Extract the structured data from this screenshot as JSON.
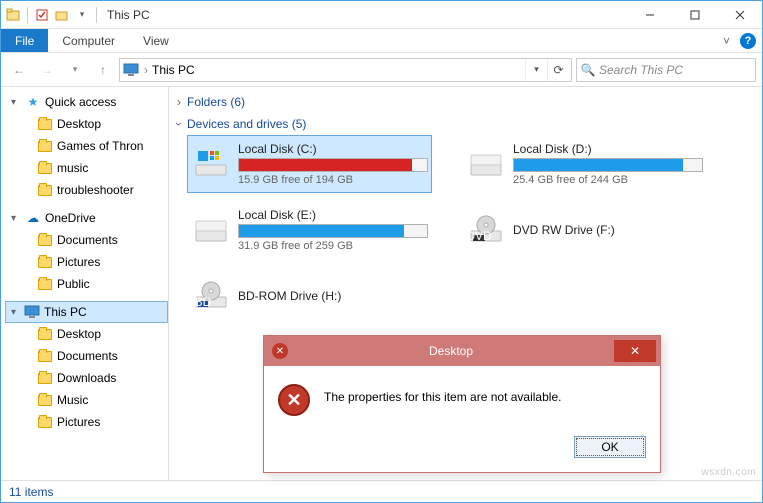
{
  "title": "This PC",
  "ribbon": {
    "file": "File",
    "computer": "Computer",
    "view": "View"
  },
  "address": {
    "segment": "This PC"
  },
  "search": {
    "placeholder": "Search This PC"
  },
  "sidebar": {
    "quick_access": "Quick access",
    "qa_items": [
      "Desktop",
      "Games of Thron",
      "music",
      "troubleshooter"
    ],
    "onedrive": "OneDrive",
    "od_items": [
      "Documents",
      "Pictures",
      "Public"
    ],
    "this_pc": "This PC",
    "pc_items": [
      "Desktop",
      "Documents",
      "Downloads",
      "Music",
      "Pictures"
    ]
  },
  "groups": {
    "folders": "Folders (6)",
    "devices": "Devices and drives (5)"
  },
  "drives": [
    {
      "name": "Local Disk (C:)",
      "free": "15.9 GB free of 194 GB",
      "fill_pct": 92,
      "color": "#d62424",
      "icon": "win",
      "selected": true
    },
    {
      "name": "Local Disk (D:)",
      "free": "25.4 GB free of 244 GB",
      "fill_pct": 90,
      "color": "#1e9be9",
      "icon": "hdd",
      "selected": false
    },
    {
      "name": "Local Disk (E:)",
      "free": "31.9 GB free of 259 GB",
      "fill_pct": 88,
      "color": "#1e9be9",
      "icon": "hdd",
      "selected": false
    },
    {
      "name": "DVD RW Drive (F:)",
      "free": "",
      "fill_pct": 0,
      "color": "",
      "icon": "dvd",
      "selected": false
    },
    {
      "name": "BD-ROM Drive (H:)",
      "free": "",
      "fill_pct": 0,
      "color": "",
      "icon": "bd",
      "selected": false
    }
  ],
  "status": "11 items",
  "dialog": {
    "title": "Desktop",
    "message": "The properties for this item are not available.",
    "ok": "OK"
  },
  "watermark": "wsxdn.com"
}
